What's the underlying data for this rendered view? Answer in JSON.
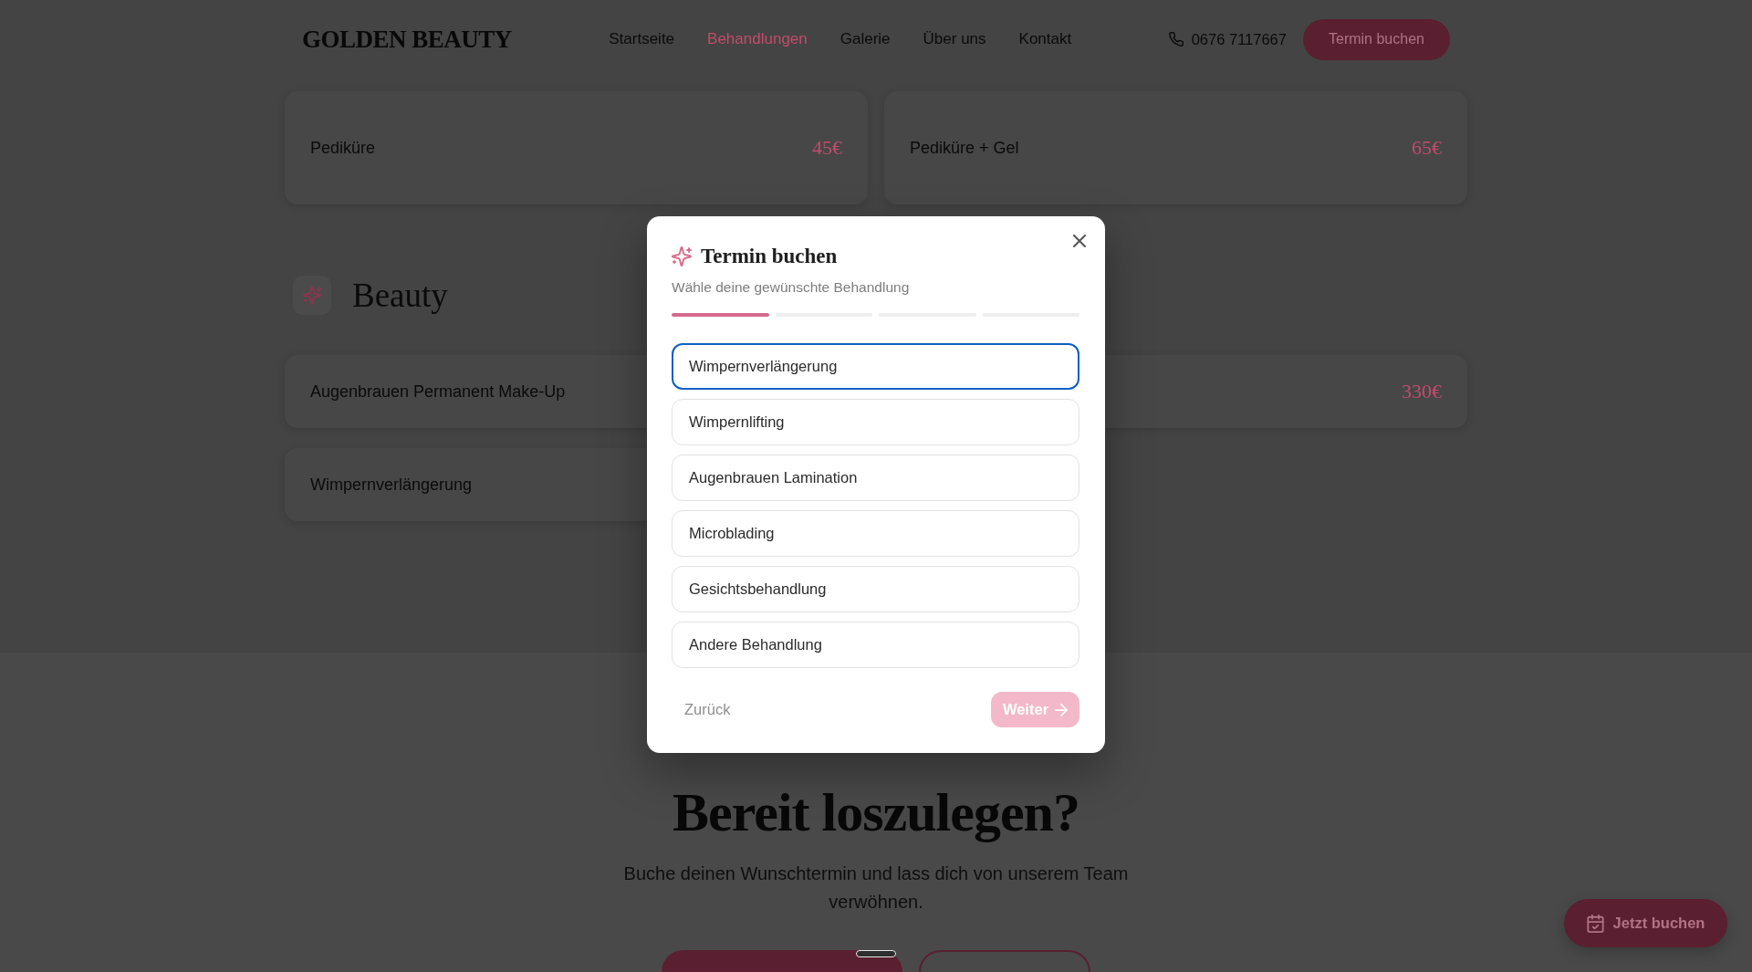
{
  "header": {
    "logo": "GOLDEN BEAUTY",
    "nav": [
      {
        "label": "Startseite",
        "selected": false
      },
      {
        "label": "Behandlungen",
        "selected": true
      },
      {
        "label": "Galerie",
        "selected": false
      },
      {
        "label": "Über uns",
        "selected": false
      },
      {
        "label": "Kontakt",
        "selected": false
      }
    ],
    "phone": "0676 7117667",
    "book_button": "Termin buchen"
  },
  "pedicure_cards": [
    {
      "title": "Pediküre",
      "price": "45€"
    },
    {
      "title": "Pediküre + Gel",
      "price": "65€"
    }
  ],
  "beauty_section": {
    "heading": "Beauty",
    "cards": [
      {
        "title": "Augenbrauen Permanent Make-Up"
      },
      {
        "price": "330€"
      },
      {
        "title": "Wimpernverlängerung"
      }
    ]
  },
  "cta_section": {
    "heading": "Bereit loszulegen?",
    "text": "Buche deinen Wunschtermin und lass dich von unserem Team verwöhnen.",
    "buttons": [
      {
        "kind": "filled"
      },
      {
        "kind": "outline"
      }
    ]
  },
  "floating_button": {
    "label": "Jetzt buchen"
  },
  "modal": {
    "title": "Termin buchen",
    "subtitle": "Wähle deine gewünschte Behandlung",
    "steps": [
      {
        "done": true
      },
      {
        "done": false
      },
      {
        "done": false
      },
      {
        "done": false
      }
    ],
    "options": [
      {
        "label": "Wimpernverlängerung",
        "selected": false,
        "focused": true
      },
      {
        "label": "Wimpernlifting",
        "selected": false,
        "focused": false
      },
      {
        "label": "Augenbrauen Lamination",
        "selected": false,
        "focused": false
      },
      {
        "label": "Microblading",
        "selected": false,
        "focused": false
      },
      {
        "label": "Gesichtsbehandlung",
        "selected": false,
        "focused": false
      },
      {
        "label": "Andere Behandlung",
        "selected": false,
        "focused": false
      }
    ],
    "back_button": "Zurück",
    "next_button": {
      "label": "Weiter",
      "disabled": true
    }
  }
}
